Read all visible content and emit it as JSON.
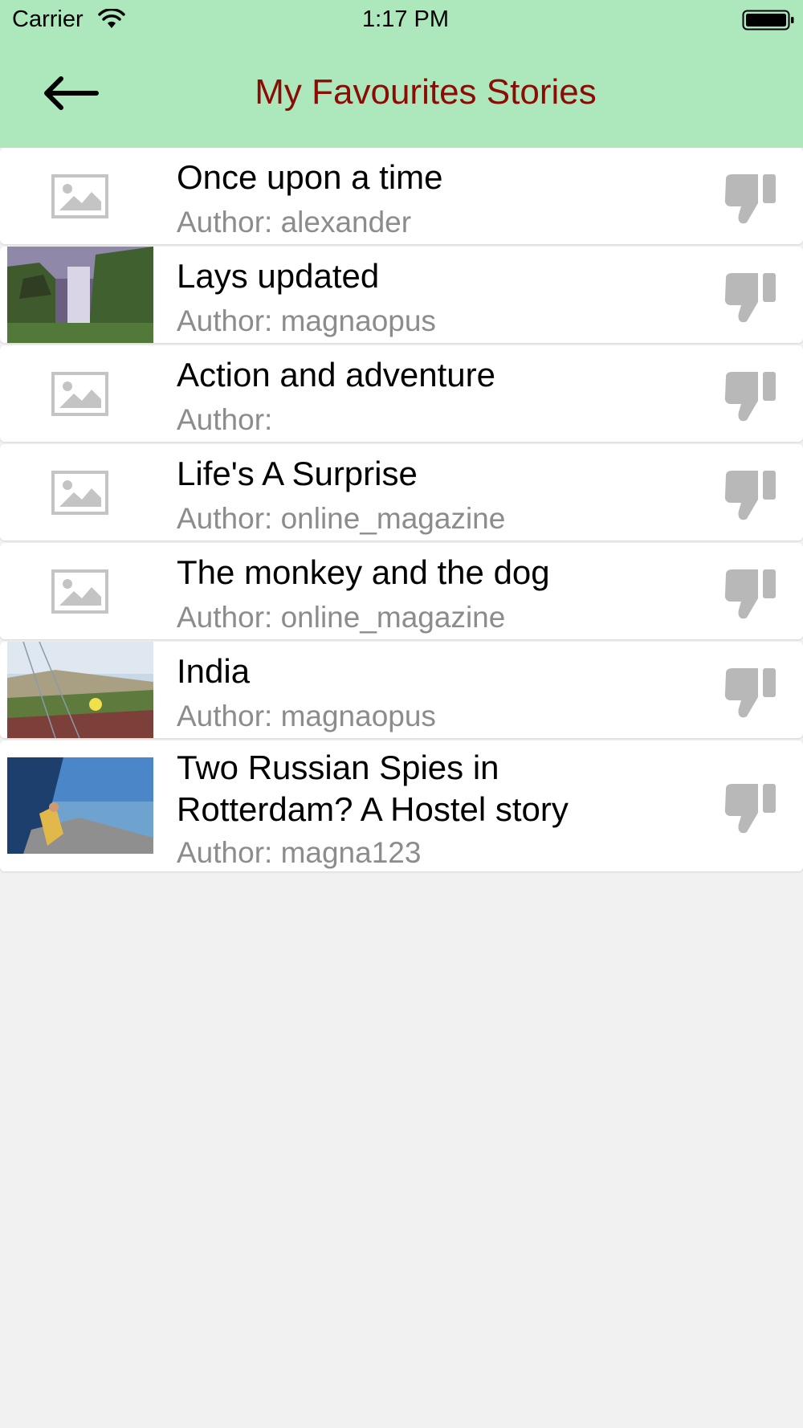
{
  "status_bar": {
    "carrier": "Carrier",
    "time": "1:17 PM"
  },
  "header": {
    "title": "My Favourites Stories",
    "back_icon": "arrow-left-icon"
  },
  "colors": {
    "header_bg": "#ace8bc",
    "title": "#8b0b05",
    "author": "#8c8c8c",
    "thumbs_icon": "#b8b8b8"
  },
  "stories": [
    {
      "title": "Once upon a time",
      "author": "Author: alexander",
      "thumbnail": "placeholder-image-icon"
    },
    {
      "title": "Lays updated",
      "author": "Author: magnaopus",
      "thumbnail": "waterfall-photo"
    },
    {
      "title": "Action and adventure",
      "author": "Author:",
      "thumbnail": "placeholder-image-icon"
    },
    {
      "title": "Life's A Surprise",
      "author": "Author: online_magazine",
      "thumbnail": "placeholder-image-icon"
    },
    {
      "title": "The monkey and the dog",
      "author": "Author: online_magazine",
      "thumbnail": "placeholder-image-icon"
    },
    {
      "title": "India",
      "author": "Author: magnaopus",
      "thumbnail": "flower-field-photo"
    },
    {
      "title_line1": "Two Russian Spies in",
      "title_line2": "Rotterdam? A Hostel story",
      "author": "Author: magna123",
      "thumbnail": "car-window-photo"
    }
  ],
  "row_action_icon": "thumbs-down-icon"
}
